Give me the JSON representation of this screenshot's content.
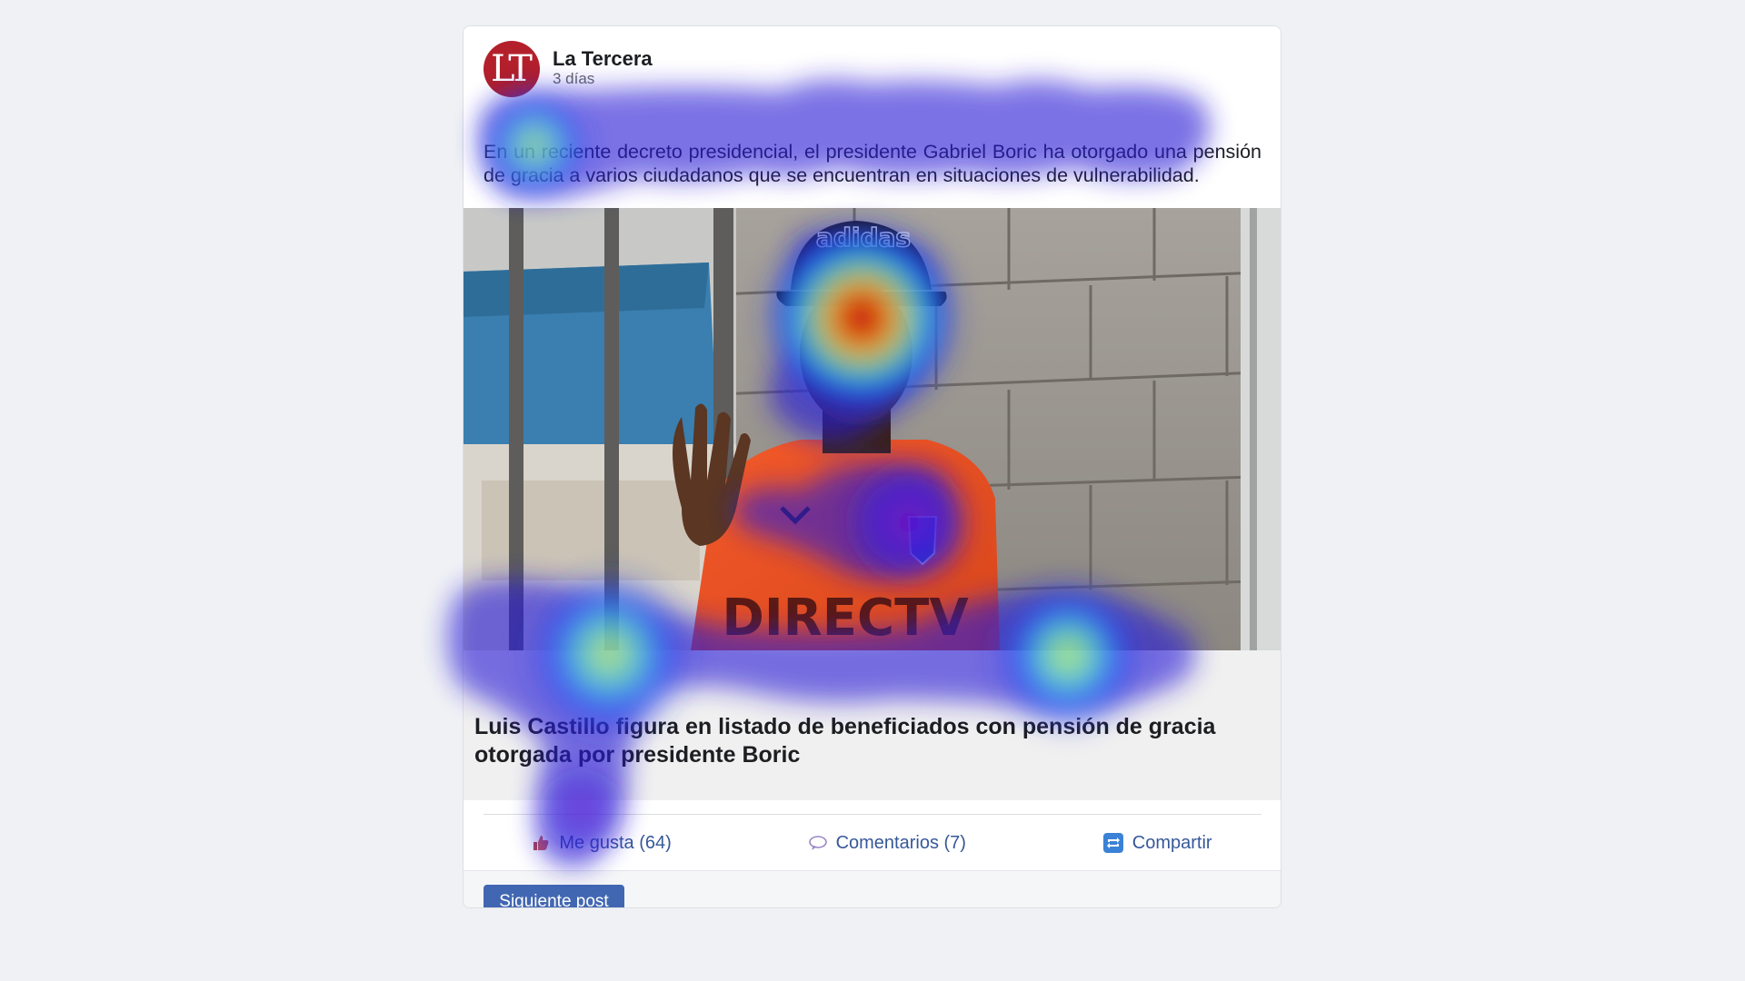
{
  "post": {
    "avatar_text": "LT",
    "source_name": "La Tercera",
    "timestamp": "3 días",
    "text": "En un reciente decreto presidencial, el presidente Gabriel Boric ha otorgado una pensión de gracia a varios ciudadanos que se encuentran en situaciones de vulnerabilidad.",
    "image_jersey_text": "DIRECTV",
    "image_cap_text": "adidas",
    "link_title": "Luis Castillo figura en listado de beneficiados con pensión de gracia otorgada por presidente Boric"
  },
  "actions": {
    "like_label": "Me gusta (64)",
    "comment_label": "Comentarios (7)",
    "share_label": "Compartir"
  },
  "footer": {
    "next_label": "Siguiente post"
  },
  "colors": {
    "brand": "#b3202b",
    "action_text": "#365899",
    "button": "#4267b2"
  }
}
